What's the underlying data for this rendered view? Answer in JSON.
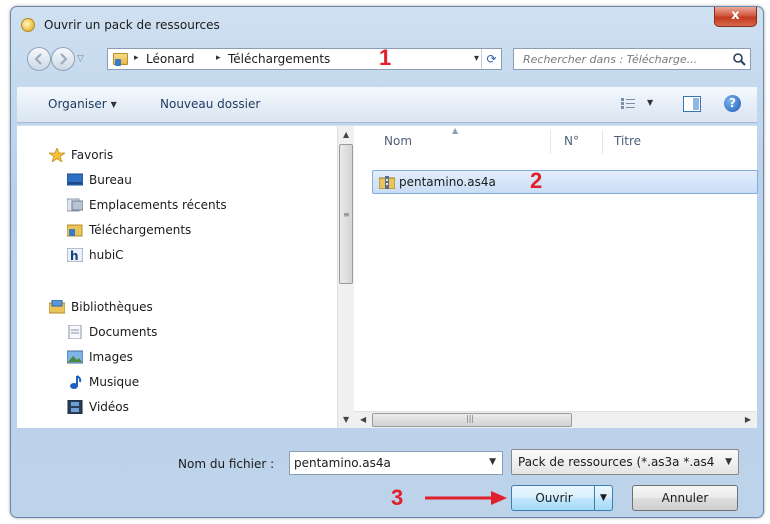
{
  "window": {
    "title": "Ouvrir un pack de ressources",
    "close_glyph": "x"
  },
  "address": {
    "crumbs": [
      "Léonard",
      "Téléchargements"
    ],
    "crumb_separator": "▸",
    "dropdown_glyph": "▾",
    "refresh_glyph": "⟳"
  },
  "search": {
    "placeholder": "Rechercher dans : Télécharge..."
  },
  "toolbar": {
    "organize_label": "Organiser",
    "new_folder_label": "Nouveau dossier",
    "help_glyph": "?"
  },
  "nav": {
    "favorites": {
      "label": "Favoris",
      "items": [
        {
          "label": "Bureau",
          "icon": "desktop-icon"
        },
        {
          "label": "Emplacements récents",
          "icon": "recent-places-icon"
        },
        {
          "label": "Téléchargements",
          "icon": "downloads-icon"
        },
        {
          "label": "hubiC",
          "icon": "hubic-icon"
        }
      ]
    },
    "libraries": {
      "label": "Bibliothèques",
      "items": [
        {
          "label": "Documents",
          "icon": "documents-icon"
        },
        {
          "label": "Images",
          "icon": "images-icon"
        },
        {
          "label": "Musique",
          "icon": "music-icon"
        },
        {
          "label": "Vidéos",
          "icon": "videos-icon"
        }
      ]
    }
  },
  "files": {
    "columns": [
      "Nom",
      "N°",
      "Titre"
    ],
    "rows": [
      {
        "name": "pentamino.as4a",
        "icon": "archive-file-icon"
      }
    ]
  },
  "footer": {
    "filename_label": "Nom du fichier :",
    "filename_value": "pentamino.as4a",
    "filter_value": "Pack de ressources (*.as3a *.as4",
    "open_label": "Ouvrir",
    "cancel_label": "Annuler"
  },
  "annotations": {
    "step1": "1",
    "step2": "2",
    "step3": "3",
    "color": "#e0202a"
  },
  "colors": {
    "selection": "#c9ddf6",
    "frame": "#b9d1ea",
    "toolbar": "#e6eef7"
  }
}
